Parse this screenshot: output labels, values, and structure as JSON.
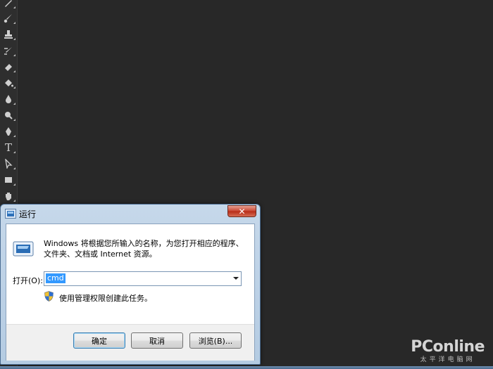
{
  "dialog": {
    "title": "运行",
    "close_label": "✕",
    "description_line1": "Windows 将根据您所输入的名称，为您打开相应的程序、",
    "description_line2": "文件夹、文档或 Internet 资源。",
    "open_label": "打开(O):",
    "open_value": "cmd",
    "admin_note": "使用管理权限创建此任务。",
    "buttons": {
      "ok": "确定",
      "cancel": "取消",
      "browse": "浏览(B)..."
    }
  },
  "watermark": {
    "brand": "PConline",
    "sub": "太平洋电脑网"
  },
  "toolbar": {
    "icons": [
      "healing-brush-icon",
      "brush-icon",
      "clone-stamp-icon",
      "history-brush-icon",
      "eraser-icon",
      "paint-bucket-icon",
      "blur-icon",
      "dodge-icon",
      "pen-icon",
      "type-icon",
      "path-selection-icon",
      "rectangle-icon",
      "hand-icon"
    ],
    "type_glyph": "T"
  },
  "colors": {
    "background": "#282828",
    "accent": "#3399ff",
    "close": "#c7432f"
  }
}
